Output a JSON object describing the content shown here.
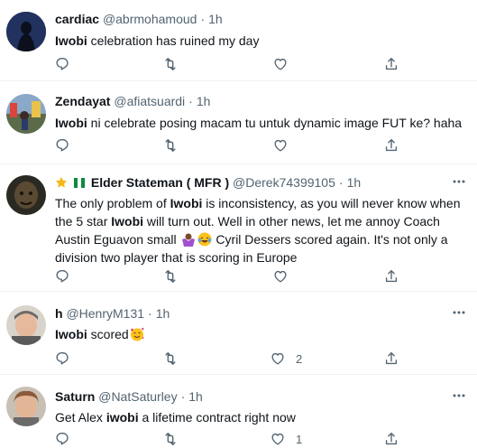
{
  "tweets": [
    {
      "name": "cardiac",
      "handle": "@abrmohamoud",
      "time": "1h",
      "text_bold": "Iwobi",
      "text_rest": " celebration has ruined my day",
      "likes": ""
    },
    {
      "name": "Zendayat",
      "handle": "@afiatsuardi",
      "time": "1h",
      "text_bold": "Iwobi",
      "text_rest": " ni celebrate posing macam tu untuk dynamic image FUT ke? haha",
      "likes": ""
    },
    {
      "name": "Elder Stateman ( MFR )",
      "handle": "@Derek74399105",
      "time": "1h",
      "text_part1": "The only problem of ",
      "text_bold1": "Iwobi",
      "text_part2": " is inconsistency, as you will never know when the 5 star ",
      "text_bold2": "Iwobi",
      "text_part3": " will turn out. Well in other news, let me annoy Coach Austin Eguavon small ",
      "text_part4": " Cyril Dessers scored again. It's not only a division two player that is scoring in Europe",
      "likes": ""
    },
    {
      "name": "h",
      "handle": "@HenryM131",
      "time": "1h",
      "text_bold": "Iwobi",
      "text_rest": " scored",
      "likes": "2"
    },
    {
      "name": "Saturn",
      "handle": "@NatSaturley",
      "time": "1h",
      "text_before": "Get Alex ",
      "text_bold": "iwobi",
      "text_rest": " a lifetime contract right now",
      "likes": "1"
    }
  ],
  "icons": {
    "reply": "reply-icon",
    "retweet": "retweet-icon",
    "like": "heart-icon",
    "share": "share-icon",
    "more": "more-icon"
  },
  "colors": {
    "secondary_text": "#536471",
    "divider": "#eff3f4",
    "icon": "#536471"
  }
}
